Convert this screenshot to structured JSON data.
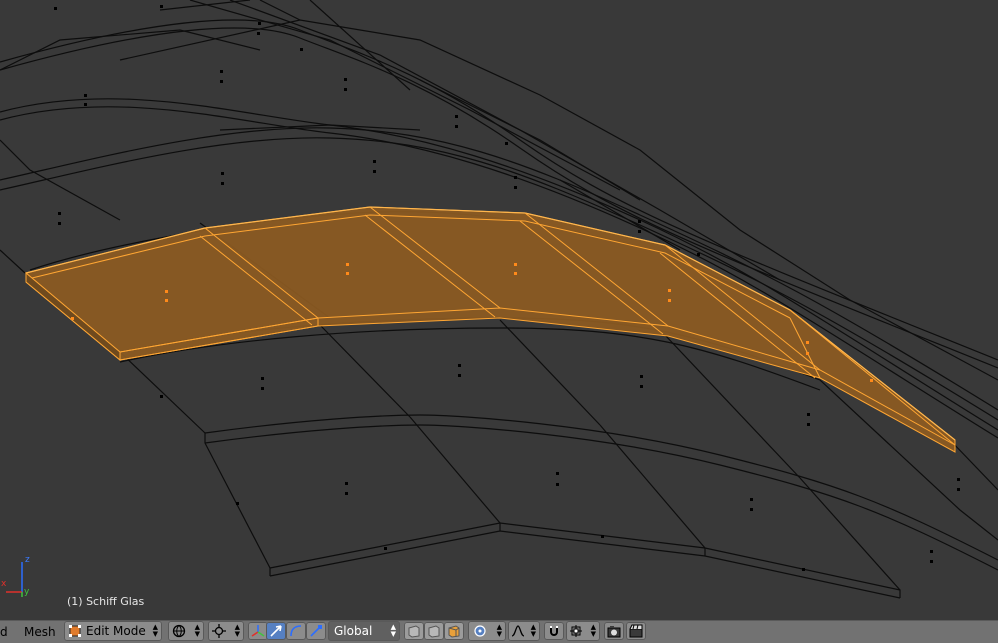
{
  "viewport": {
    "object_label": "(1) Schiff Glas",
    "axes": {
      "z": "z",
      "y": "y",
      "x": "x"
    }
  },
  "header": {
    "left_menu_partial": "d",
    "menu_mesh": "Mesh",
    "mode_dropdown": {
      "value": "Edit Mode",
      "icon": "edit-mode-icon"
    },
    "transform_orientation": {
      "value": "Global"
    },
    "icons": [
      "viewport-shading-icon",
      "pivot-point-icon",
      "manipulator-toggle-icon",
      "translate-manipulator-icon",
      "rotate-manipulator-icon",
      "scale-manipulator-icon",
      "vertex-select-icon",
      "edge-select-icon",
      "face-select-icon",
      "proportional-editing-icon",
      "falloff-icon",
      "snap-toggle-icon",
      "snap-element-icon",
      "opengl-render-icon",
      "opengl-render-animation-icon"
    ]
  },
  "colors": {
    "background": "#393939",
    "selection": "#ffa633",
    "selection_fill": "#8a5a22",
    "wire": "#000000",
    "header": "#727272",
    "active_button": "#5680c2"
  }
}
